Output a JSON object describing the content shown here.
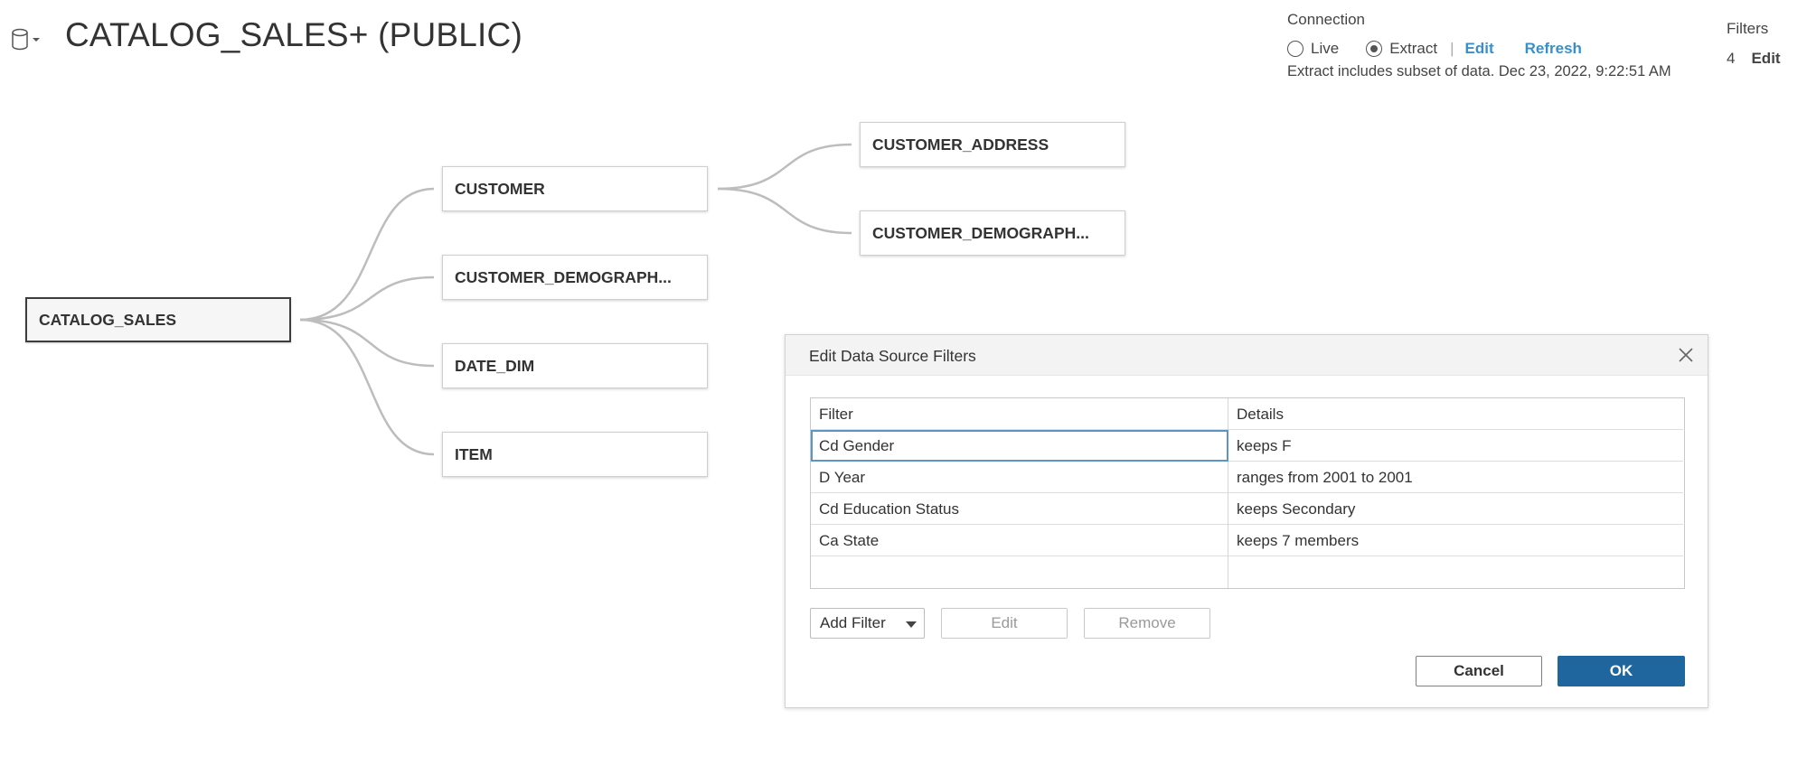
{
  "header": {
    "title": "CATALOG_SALES+ (PUBLIC)"
  },
  "connection": {
    "label": "Connection",
    "live_label": "Live",
    "extract_label": "Extract",
    "selected": "Extract",
    "separator": "|",
    "edit_label": "Edit",
    "refresh_label": "Refresh",
    "note": "Extract includes subset of data. Dec 23, 2022, 9:22:51 AM"
  },
  "filters_panel": {
    "label": "Filters",
    "count": "4",
    "edit_label": "Edit"
  },
  "canvas": {
    "tables": {
      "root": "CATALOG_SALES",
      "customer": "CUSTOMER",
      "customer_demographics": "CUSTOMER_DEMOGRAPH...",
      "date_dim": "DATE_DIM",
      "item": "ITEM",
      "customer_address": "CUSTOMER_ADDRESS",
      "customer_demographics_2": "CUSTOMER_DEMOGRAPH..."
    }
  },
  "dialog": {
    "title": "Edit Data Source Filters",
    "columns": {
      "filter": "Filter",
      "details": "Details"
    },
    "rows": [
      {
        "filter": "Cd Gender",
        "details": "keeps F"
      },
      {
        "filter": "D Year",
        "details": "ranges from 2001 to 2001"
      },
      {
        "filter": "Cd Education Status",
        "details": "keeps Secondary"
      },
      {
        "filter": "Ca State",
        "details": "keeps 7 members"
      }
    ],
    "buttons": {
      "add_filter": "Add Filter",
      "edit": "Edit",
      "remove": "Remove",
      "cancel": "Cancel",
      "ok": "OK"
    }
  },
  "colors": {
    "link": "#3a8fcb",
    "ok_button": "#1f669e",
    "selection": "#5b95c6",
    "connector": "#bdbdbd"
  },
  "icons": {
    "datasource": "database-icon",
    "dropdown": "caret-down-icon",
    "close": "close-icon"
  }
}
